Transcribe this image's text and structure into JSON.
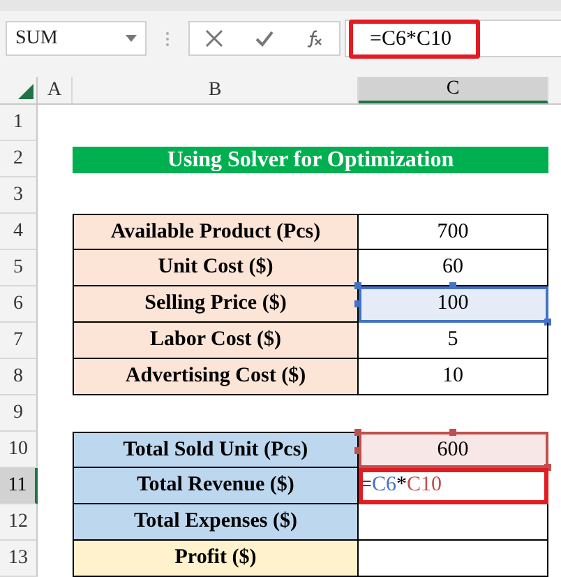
{
  "name_box": {
    "value": "SUM"
  },
  "formula_bar": {
    "formula": "=C6*C10",
    "annotated": true
  },
  "columns": [
    {
      "label": "A",
      "selected": false
    },
    {
      "label": "B",
      "selected": false
    },
    {
      "label": "C",
      "selected": true
    }
  ],
  "rows": [
    {
      "number": "1",
      "selected": false,
      "kind": "blank"
    },
    {
      "number": "2",
      "selected": false,
      "kind": "title",
      "text": "Using Solver for Optimization"
    },
    {
      "number": "3",
      "selected": false,
      "kind": "blank"
    },
    {
      "number": "4",
      "selected": false,
      "kind": "input",
      "label": "Available Product (Pcs)",
      "value": "700"
    },
    {
      "number": "5",
      "selected": false,
      "kind": "input",
      "label": "Unit Cost ($)",
      "value": "60"
    },
    {
      "number": "6",
      "selected": false,
      "kind": "input",
      "label": "Selling Price ($)",
      "value": "100",
      "color": "#4472c4"
    },
    {
      "number": "7",
      "selected": false,
      "kind": "input",
      "label": "Labor Cost ($)",
      "value": "5"
    },
    {
      "number": "8",
      "selected": false,
      "kind": "input",
      "label": "Advertising Cost ($)",
      "value": "10"
    },
    {
      "number": "9",
      "selected": false,
      "kind": "blank"
    },
    {
      "number": "10",
      "selected": false,
      "kind": "output",
      "label": "Total Sold Unit (Pcs)",
      "value": "600",
      "color": "#c0504d"
    },
    {
      "number": "11",
      "selected": true,
      "kind": "output",
      "label": "Total Revenue ($)",
      "annotated": true,
      "formula_parts": [
        {
          "text": "="
        },
        {
          "text": "C6",
          "color": "#4472c4"
        },
        {
          "text": "*"
        },
        {
          "text": "C10",
          "color": "#c0504d"
        }
      ]
    },
    {
      "number": "12",
      "selected": false,
      "kind": "output",
      "label": "Total Expenses ($)"
    },
    {
      "number": "13",
      "selected": false,
      "kind": "profit",
      "label": "Profit ($)"
    }
  ]
}
